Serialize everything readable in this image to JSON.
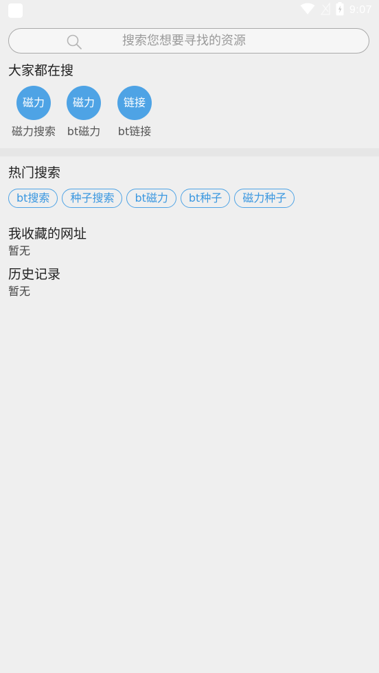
{
  "status_bar": {
    "time": "9:07",
    "icons": [
      "app-notification-icon",
      "wifi-icon",
      "signal-icon",
      "battery-icon"
    ]
  },
  "search": {
    "placeholder": "搜索您想要寻找的资源",
    "icon": "search-icon"
  },
  "popular": {
    "title": "大家都在搜",
    "items": [
      {
        "circle_text": "磁力",
        "label": "磁力搜索"
      },
      {
        "circle_text": "磁力",
        "label": "bt磁力"
      },
      {
        "circle_text": "链接",
        "label": "bt链接"
      }
    ]
  },
  "hot_search": {
    "title": "热门搜索",
    "tags": [
      "bt搜索",
      "种子搜索",
      "bt磁力",
      "bt种子",
      "磁力种子"
    ]
  },
  "favorites": {
    "title": "我收藏的网址",
    "empty": "暂无"
  },
  "history": {
    "title": "历史记录",
    "empty": "暂无"
  },
  "colors": {
    "accent": "#4ea3e5",
    "background": "#efefef",
    "status_text": "#ffffff"
  }
}
